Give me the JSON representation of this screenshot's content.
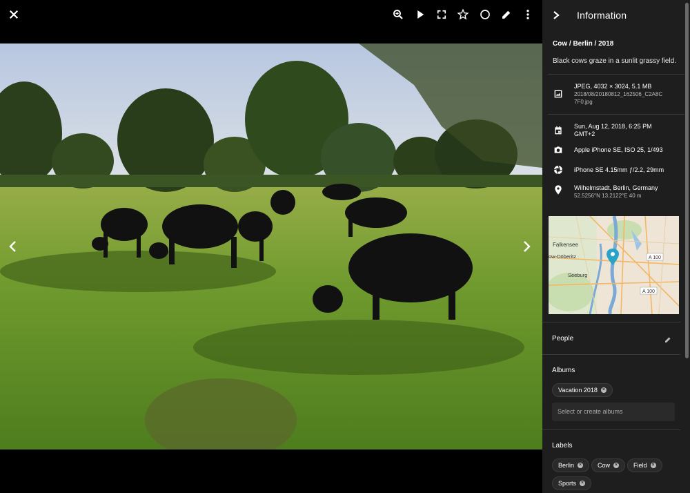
{
  "toolbar": {
    "close": "close-icon",
    "actions": [
      "zoom-icon",
      "play-icon",
      "fullscreen-icon",
      "star-icon",
      "circle-icon",
      "edit-icon",
      "more-icon"
    ]
  },
  "panel": {
    "title": "Information",
    "photo_title": "Cow / Berlin / 2018",
    "description": "Black cows graze in a sunlit grassy field.",
    "file": {
      "line1": "JPEG, 4032 × 3024, 5.1 MB",
      "line2": "2018/08/20180812_162506_C2A8C",
      "line3": "7F0.jpg"
    },
    "date": {
      "line1": "Sun, Aug 12, 2018, 6:25 PM",
      "line2": "GMT+2"
    },
    "camera": "Apple iPhone SE, ISO 25, 1/493",
    "lens": "iPhone SE 4.15mm ƒ/2.2, 29mm",
    "location": {
      "line1": "Wilhelmstadt, Berlin, Germany",
      "line2": "52.5256°N  13.2122°E  40 m"
    },
    "map": {
      "labels": [
        "Falkensee",
        "ow-Döberitz",
        "Seeburg"
      ],
      "roads": [
        "A 100",
        "A 100"
      ]
    },
    "people_label": "People",
    "albums_label": "Albums",
    "albums": [
      "Vacation 2018"
    ],
    "albums_placeholder": "Select or create albums",
    "labels_label": "Labels",
    "labels": [
      "Berlin",
      "Cow",
      "Field",
      "Sports"
    ]
  },
  "colors": {
    "panel_bg": "#1e1e1e",
    "map_pin": "#29a3c7",
    "chip_bg": "#2a2a2a"
  }
}
